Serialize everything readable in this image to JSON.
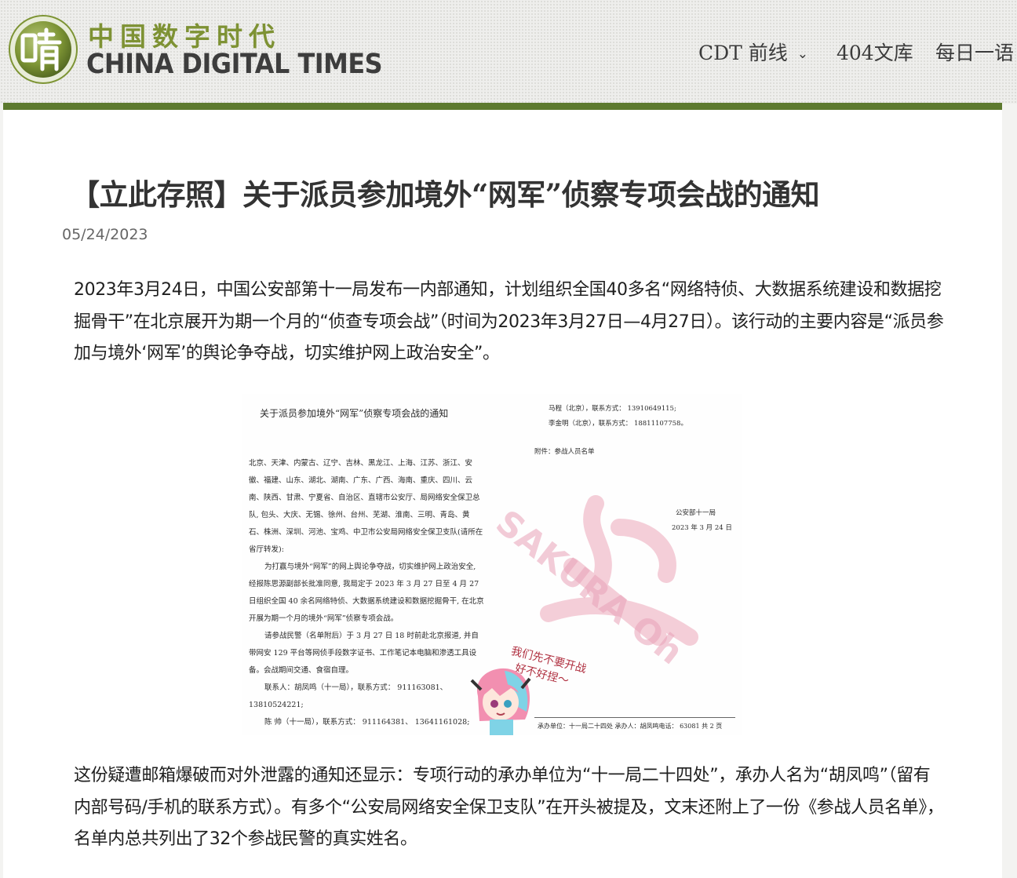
{
  "header": {
    "logo_cn": "中国数字时代",
    "logo_en": "CHINA DIGITAL TIMES",
    "nav": [
      {
        "label": "CDT 前线",
        "has_dropdown": true
      },
      {
        "label": "404文库"
      },
      {
        "label": "每日一语"
      }
    ],
    "accent_color": "#5d7a2f"
  },
  "article": {
    "title": "【立此存照】关于派员参加境外“网军”侦察专项会战的通知",
    "date": "05/24/2023",
    "paragraph1": "2023年3月24日，中国公安部第十一局发布一内部通知，计划组织全国40多名“网络特侦、大数据系统建设和数据挖掘骨干”在北京展开为期一个月的“侦查专项会战”（时间为2023年3月27日—4月27日）。该行动的主要内容是“派员参加与境外‘网军’的舆论争夺战，切实维护网上政治安全”。",
    "paragraph2": "这份疑遭邮箱爆破而对外泄露的通知还显示：专项行动的承办单位为“十一局二十四处”，承办人名为“胡凤鸣”（留有内部号码/手机的联系方式）。有多个“公安局网络安全保卫支队”在开头被提及，文末还附上了一份《参战人员名单》，名单内总共列出了32个参战民警的真实姓名。"
  },
  "document_image": {
    "title": "关于派员参加境外“网军”侦察专项会战的通知",
    "body_p1": "北京、天津、内蒙古、辽宁、吉林、黑龙江、上海、江苏、浙江、安徽、福建、山东、湖北、湖南、广东、广西、海南、重庆、四川、云南、陕西、甘肃、宁夏省、自治区、直辖市公安厅、局网络安全保卫总队, 包头、大庆、无锡、徐州、台州、芜湖、淮南、三明、青岛、黄石、株洲、深圳、河池、宝鸡、中卫市公安局网络安全保卫支队(请所在省厅转发):",
    "body_p2": "为打赢与境外“网军”的网上舆论争夺战，切实维护网上政治安全, 经报陈思源副部长批准同意, 我局定于 2023 年 3 月 27 日至 4 月 27 日组织全国 40 余名网络特侦、大数据系统建设和数据挖掘骨干, 在北京开展为期一个月的境外“网军”侦察专项会战。",
    "body_p3": "请参战民警（名单附后）于 3 月 27 日 18 时前赴北京报道, 并自带网安 129 平台等网侦手段数字证书、工作笔记本电脑和渗透工具设备。会战期间交通、食宿自理。",
    "contact1": "联系人：胡凤鸣（十一局），联系方式： 911163081、",
    "contact1b": "13810524221;",
    "contact2": "陈 帅（十一局），联系方式： 911164381、 13641161028;",
    "contact3": "马程（北京），联系方式： 13910649115;",
    "contact4": "李金明（北京），联系方式： 18811107758。",
    "attachment": "附件：参战人员名单",
    "issuer": "公安部十一局",
    "issue_date": "2023 年 3 月 24 日",
    "footer": "承办单位：十一局二十四处  承办人：胡凤鸣电话： 63081 共 2 页",
    "watermark_text": "SAKURA Oh",
    "sticker_line1": "我们先不要开战",
    "sticker_line2": "好不好捏～"
  }
}
